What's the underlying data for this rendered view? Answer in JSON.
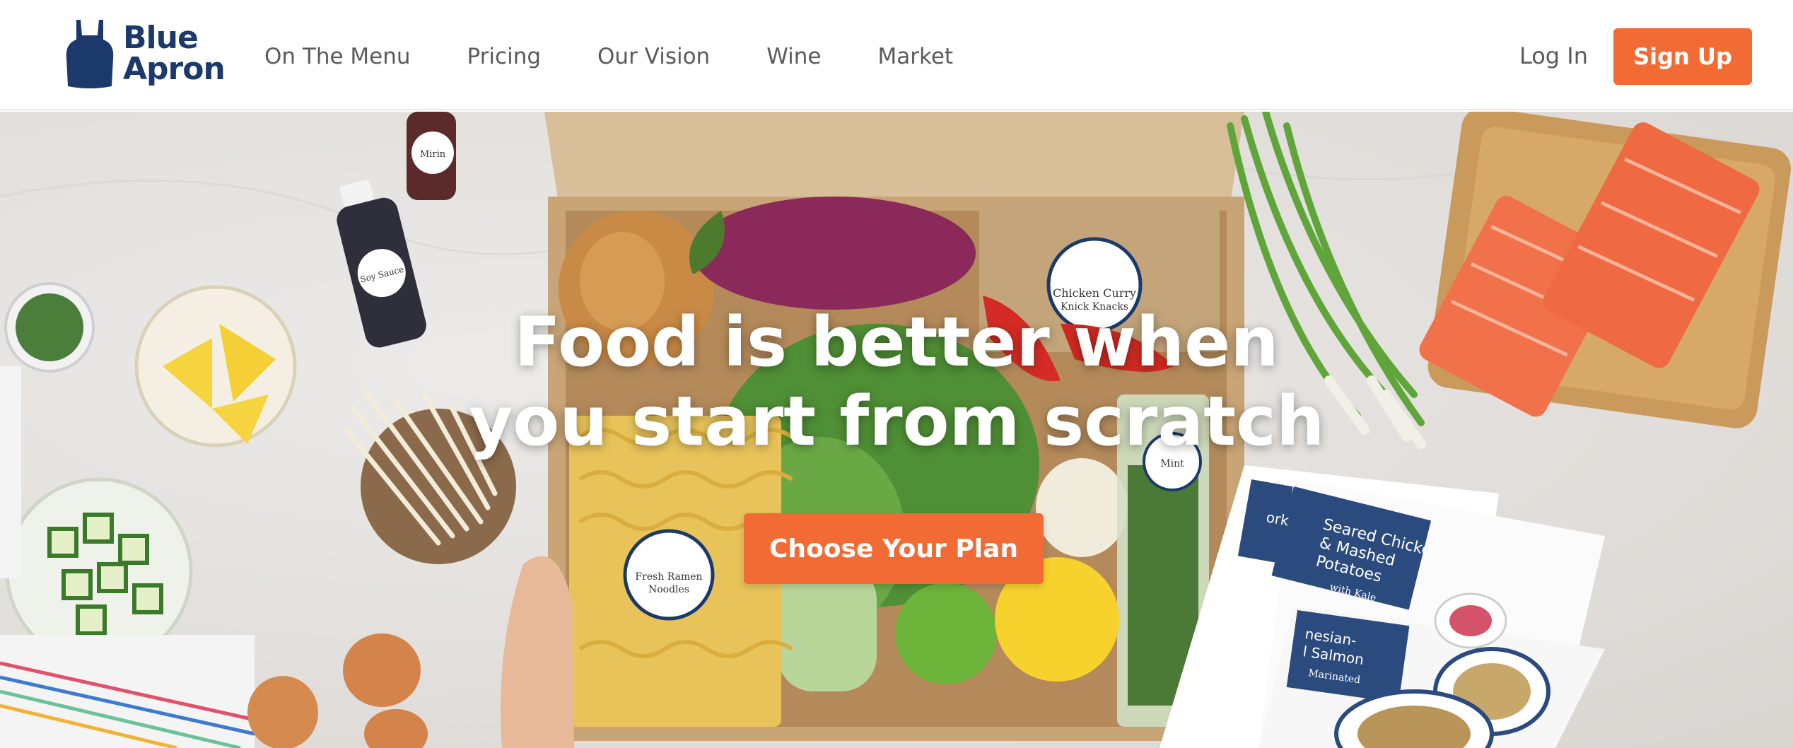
{
  "brand": {
    "line1": "Blue",
    "line2": "Apron"
  },
  "nav": {
    "items": [
      "On The Menu",
      "Pricing",
      "Our Vision",
      "Wine",
      "Market"
    ]
  },
  "auth": {
    "login_label": "Log In",
    "signup_label": "Sign Up"
  },
  "hero": {
    "title_line1": "Food is better when",
    "title_line2": "you start from scratch",
    "cta_label": "Choose Your Plan"
  },
  "product_labels": {
    "mirin": "Mirin",
    "soy_sauce": "Soy Sauce",
    "chicken_curry_line1": "Chicken Curry",
    "chicken_curry_line2": "Knick Knacks",
    "mint": "Mint",
    "noodles_line1": "Fresh Ramen",
    "noodles_line2": "Noodles"
  },
  "recipe_cards": {
    "card1_title_line1": "Seared Chicken",
    "card1_title_line2": "& Mashed",
    "card1_title_line3": "Potatoes",
    "card1_sub": "with Kale",
    "card2_title_line1": "nesian-",
    "card2_title_line2": "l Salmon",
    "card2_sub": "Marinated",
    "card3_fragment": "ork"
  },
  "colors": {
    "brand_navy": "#1b3a6b",
    "accent_orange": "#f26b34",
    "nav_text": "#5b5b5b"
  }
}
